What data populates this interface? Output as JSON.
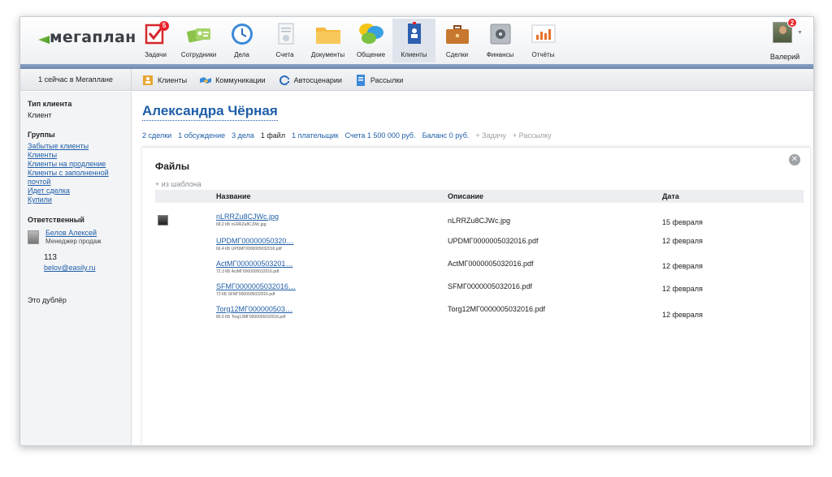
{
  "app": {
    "logo": "мегаплан"
  },
  "nav": [
    {
      "label": "Задачи",
      "icon": "tasks-icon",
      "badge": "5"
    },
    {
      "label": "Сотрудники",
      "icon": "employees-icon"
    },
    {
      "label": "Дела",
      "icon": "clock-icon"
    },
    {
      "label": "Счета",
      "icon": "invoice-icon"
    },
    {
      "label": "Документы",
      "icon": "folder-icon"
    },
    {
      "label": "Общение",
      "icon": "chat-icon"
    },
    {
      "label": "Клиенты",
      "icon": "contacts-icon",
      "active": true
    },
    {
      "label": "Сделки",
      "icon": "briefcase-icon"
    },
    {
      "label": "Финансы",
      "icon": "safe-icon"
    },
    {
      "label": "Отчёты",
      "icon": "reports-icon"
    }
  ],
  "user": {
    "name": "Валерий",
    "badge": "2"
  },
  "subbar": {
    "online": "1 сейчас в Мегаплане",
    "items": [
      {
        "label": "Клиенты",
        "icon": "clients-icon"
      },
      {
        "label": "Коммуникации",
        "icon": "handshake-icon"
      },
      {
        "label": "Автосценарии",
        "icon": "autoscenario-icon"
      },
      {
        "label": "Рассылки",
        "icon": "mailing-icon"
      }
    ]
  },
  "sidebar": {
    "type_head": "Тип клиента",
    "type_value": "Клиент",
    "groups_head": "Группы",
    "groups": [
      "Забытые клиенты",
      "Клиенты",
      "Клиенты на продление",
      "Клиенты с заполненной почтой",
      "Идет сделка",
      "Купили"
    ],
    "resp_head": "Ответственный",
    "resp_name": "Белов Алексей",
    "resp_role": "Менеджер продаж",
    "resp_number": "113",
    "resp_email": "belov@easily.ru",
    "note": "Это дублёр"
  },
  "client": {
    "name": "Александра Чёрная",
    "tabs": [
      "2 сделки",
      "1 обсуждение",
      "3 дела",
      "1 файл",
      "1 плательщик",
      "Счета 1 500 000 руб.",
      "Баланс 0 руб."
    ],
    "add_task": "+ Задачу",
    "add_mailing": "+ Рассылку"
  },
  "files": {
    "title": "Файлы",
    "from_template": "+ из шаблона",
    "col_name": "Название",
    "col_desc": "Описание",
    "col_date": "Дата",
    "rows": [
      {
        "name": "nLRRZu8CJWc.jpg",
        "meta": "68,2 КБ nLRRZu8CJWc.jpg",
        "desc": "nLRRZu8CJWc.jpg",
        "date": "15 февраля"
      },
      {
        "name": "UPDМГ00000050320…",
        "meta": "66.4 КБ UPDМГ0000005032016.pdf",
        "desc": "UPDМГ0000005032016.pdf",
        "date": "12 февраля"
      },
      {
        "name": "ActМГ000000503201…",
        "meta": "72.3 КБ ActМГ0000005032016.pdf",
        "desc": "ActМГ0000005032016.pdf",
        "date": "12 февраля"
      },
      {
        "name": "SFМГ0000005032016…",
        "meta": "73 КБ SFМГ0000005032016.pdf",
        "desc": "SFМГ0000005032016.pdf",
        "date": "12 февраля"
      },
      {
        "name": "Torg12МГ000000503…",
        "meta": "85.5 КБ Torg12МГ0000005032016.pdf",
        "desc": "Torg12МГ0000005032016.pdf",
        "date": "12 февраля"
      }
    ]
  }
}
